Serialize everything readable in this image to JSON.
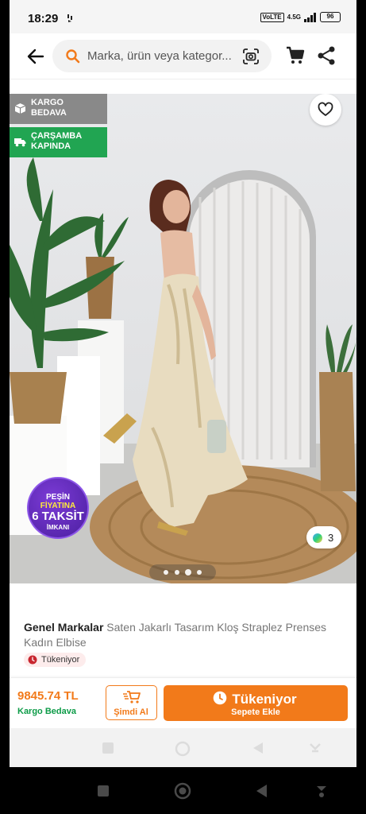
{
  "status_bar": {
    "time": "18:29",
    "network_badge": "VoLTE",
    "network_type": "4.5G",
    "battery": "96"
  },
  "header": {
    "search_placeholder": "Marka, ürün veya kategor..."
  },
  "product_image": {
    "tag_shipping": "KARGO BEDAVA",
    "tag_delivery": "ÇARŞAMBA KAPINDA",
    "promo_badge": {
      "line1": "PEŞİN",
      "line2": "FİYATINA",
      "line3": "6 TAKSİT",
      "line4": "İMKANI"
    },
    "color_count": "3",
    "pager": {
      "total": 4,
      "active": 3
    }
  },
  "product": {
    "brand": "Genel Markalar",
    "name": "Saten Jakarlı Tasarım Kloş Straplez Prenses Kadın Elbise",
    "stock_status": "Tükeniyor"
  },
  "action_bar": {
    "price": "9845.74 TL",
    "shipping": "Kargo Bedava",
    "buy_now_label": "Şimdi Al",
    "main_button_label": "Tükeniyor",
    "main_button_sub": "Sepete Ekle"
  },
  "colors": {
    "accent": "#f27a1a",
    "green": "#21a552",
    "price_sub_green": "#0c9b47"
  }
}
